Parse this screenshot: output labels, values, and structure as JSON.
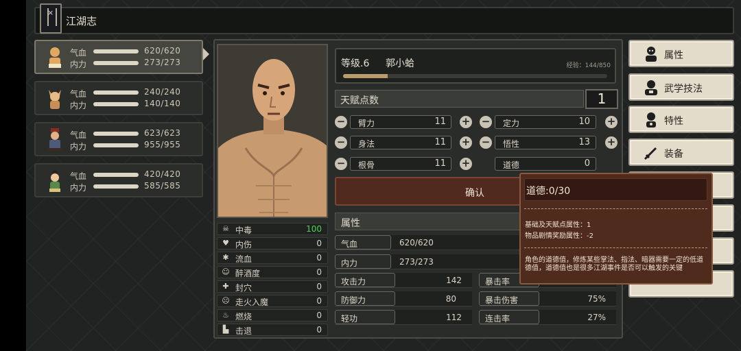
{
  "header": {
    "title": "江湖志",
    "book_icon": "book-icon"
  },
  "party": [
    {
      "hp_label": "气血",
      "mp_label": "内力",
      "hp": "620/620",
      "mp": "273/273",
      "active": true
    },
    {
      "hp_label": "气血",
      "mp_label": "内力",
      "hp": "240/240",
      "mp": "140/140",
      "active": false
    },
    {
      "hp_label": "气血",
      "mp_label": "内力",
      "hp": "623/623",
      "mp": "955/955",
      "active": false
    },
    {
      "hp_label": "气血",
      "mp_label": "内力",
      "hp": "420/420",
      "mp": "585/585",
      "active": false
    }
  ],
  "status": [
    {
      "name": "中毒",
      "value": "100",
      "icon": "skull-icon"
    },
    {
      "name": "内伤",
      "value": "0",
      "icon": "broken-heart-icon"
    },
    {
      "name": "流血",
      "value": "0",
      "icon": "blood-drop-icon"
    },
    {
      "name": "醉酒度",
      "value": "0",
      "icon": "wine-icon"
    },
    {
      "name": "封穴",
      "value": "0",
      "icon": "seal-icon"
    },
    {
      "name": "走火入魔",
      "value": "0",
      "icon": "demon-icon"
    },
    {
      "name": "燃烧",
      "value": "0",
      "icon": "fire-icon"
    },
    {
      "name": "击退",
      "value": "0",
      "icon": "boot-icon"
    }
  ],
  "character": {
    "level_label": "等级.6",
    "name": "郭小蛤",
    "exp_text": "经验：144/850",
    "exp_progress": 0.169
  },
  "talent": {
    "label": "天赋点数",
    "points": "1"
  },
  "attrs_left": [
    {
      "name": "臂力",
      "value": "11"
    },
    {
      "name": "身法",
      "value": "11"
    },
    {
      "name": "根骨",
      "value": "11"
    }
  ],
  "attrs_right": [
    {
      "name": "定力",
      "value": "10"
    },
    {
      "name": "悟性",
      "value": "13"
    },
    {
      "name": "道德",
      "value": "0"
    }
  ],
  "confirm_label": "确认",
  "attributes": {
    "title": "属性",
    "hp": {
      "label": "气血",
      "value": "620/620"
    },
    "mp": {
      "label": "内力",
      "value": "273/273"
    },
    "left": [
      {
        "label": "攻击力",
        "value": "142"
      },
      {
        "label": "防御力",
        "value": "80"
      },
      {
        "label": "轻功",
        "value": "112"
      }
    ],
    "right": [
      {
        "label": "暴击率",
        "value": ""
      },
      {
        "label": "暴击伤害",
        "value": "75%"
      },
      {
        "label": "连击率",
        "value": "27%"
      }
    ]
  },
  "menu": [
    {
      "label": "属性",
      "icon": "character-icon"
    },
    {
      "label": "武学技法",
      "icon": "martial-icon"
    },
    {
      "label": "特性",
      "icon": "trait-icon"
    },
    {
      "label": "装备",
      "icon": "sword-icon"
    }
  ],
  "tooltip": {
    "title": "道德:0/30",
    "line1": "基础及天赋点属性：1",
    "line2": "物品剧情奖励属性：-2",
    "desc": "角色的道德值，修炼某些掌法、指法、暗器需要一定的低道德值，道德值也是很多江湖事件是否可以触发的关键"
  },
  "colors": {
    "accent_red": "#512a1f",
    "tooltip_bg": "#4f2b1e",
    "poison_green": "#4fd34f",
    "menu_bg": "#e3dccb"
  }
}
